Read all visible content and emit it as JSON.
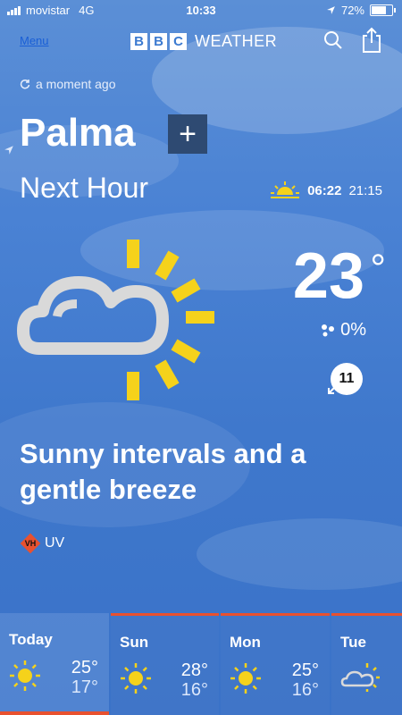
{
  "status_bar": {
    "carrier": "movistar",
    "network": "4G",
    "time": "10:33",
    "battery": "72%",
    "battery_level": 0.72
  },
  "header": {
    "menu_label": "Menu",
    "brand_letters": [
      "B",
      "B",
      "C"
    ],
    "brand_word": "WEATHER"
  },
  "location": {
    "updated": "a moment ago",
    "city": "Palma",
    "add_label": "+"
  },
  "now": {
    "period": "Next Hour",
    "sunrise": "06:22",
    "sunset": "21:15",
    "temperature": "23",
    "degree_symbol": "°",
    "precip": "0%",
    "wind_speed": "11",
    "description": "Sunny intervals and a gentle breeze",
    "uv_badge": "VH",
    "uv_label": "UV",
    "weather_icon": "sunny-intervals-icon"
  },
  "forecast": [
    {
      "day": "Today",
      "high": "25°",
      "low": "17°",
      "icon": "sun-icon"
    },
    {
      "day": "Sun",
      "high": "28°",
      "low": "16°",
      "icon": "sun-icon"
    },
    {
      "day": "Mon",
      "high": "25°",
      "low": "16°",
      "icon": "sun-icon"
    },
    {
      "day": "Tue",
      "high": "",
      "low": "",
      "icon": "sunny-intervals-icon"
    }
  ],
  "colors": {
    "accent": "#e8512f",
    "sun": "#f5d21b",
    "cloud": "#d9d9d9"
  }
}
